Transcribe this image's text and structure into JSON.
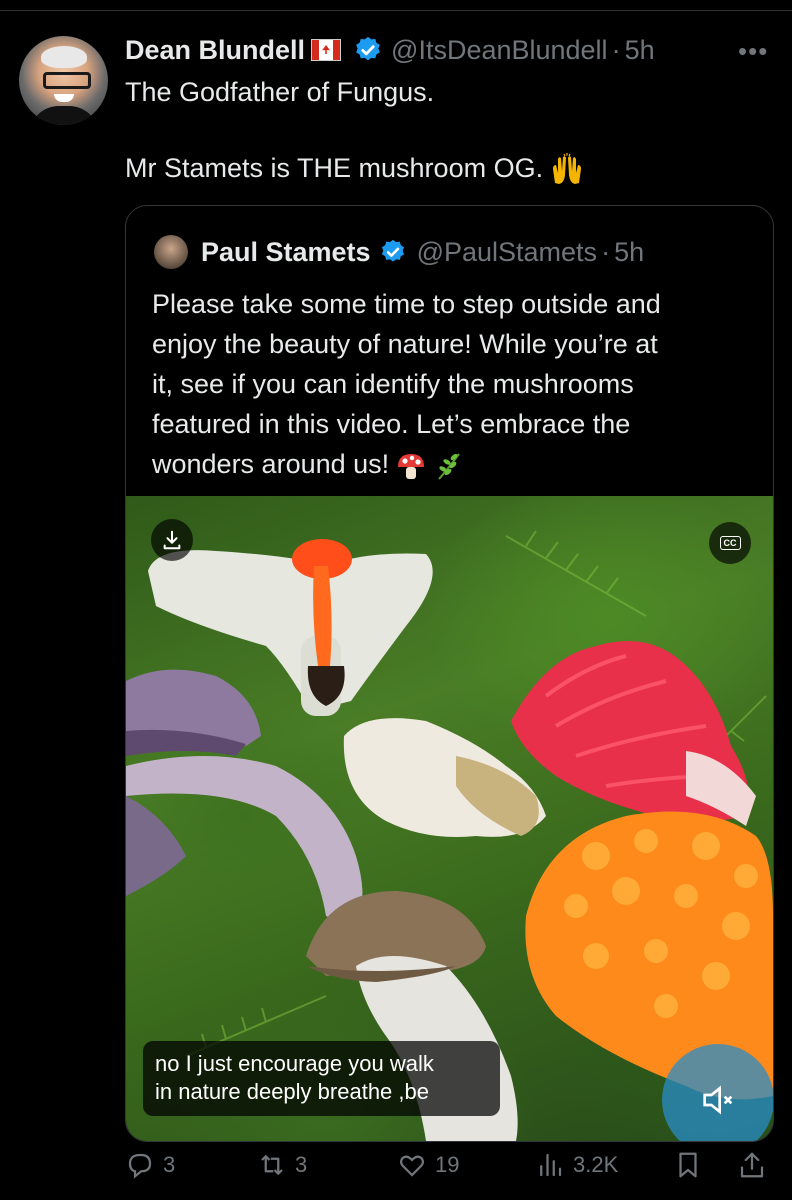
{
  "author": {
    "name": "Dean Blundell",
    "handle": "@ItsDeanBlundell",
    "time": "5h",
    "more_icon": "more-horizontal-icon"
  },
  "tweet": {
    "line1": "The Godfather of Fungus.",
    "line2": "Mr Stamets is THE mushroom OG."
  },
  "quote": {
    "name": "Paul Stamets",
    "handle": "@PaulStamets",
    "time": "5h",
    "lines": [
      "Please take some time to step outside and",
      "enjoy the beauty of nature! While you’re at",
      "it, see if you can identify the mushrooms",
      "featured in this video. Let’s embrace the",
      "wonders around us!"
    ],
    "video": {
      "caption_line1": "no I just encourage you walk",
      "caption_line2": "in nature deeply breathe ,be",
      "cc_label": "CC"
    }
  },
  "actions": {
    "replies": "3",
    "reposts": "3",
    "likes": "19",
    "views": "3.2K"
  },
  "colors": {
    "background": "#000000",
    "text": "#e7e9ea",
    "muted": "#71767b",
    "verified": "#1d9bf0",
    "border": "#333639"
  },
  "sep": "·"
}
